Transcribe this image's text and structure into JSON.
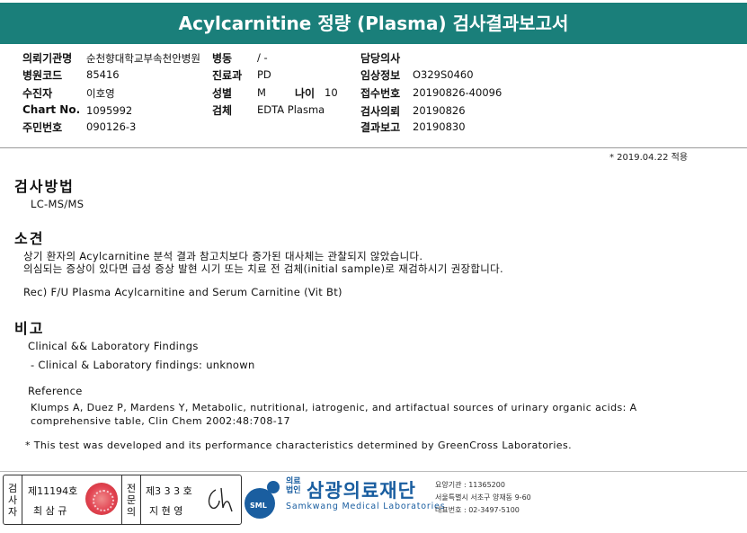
{
  "header": {
    "title": "Acylcarnitine 정량 (Plasma) 검사결과보고서"
  },
  "info": {
    "institution_label": "의뢰기관명",
    "institution_value": "순천향대학교부속천안병원",
    "ward_label": "병동",
    "ward_value": "/ -",
    "doctor_label": "담당의사",
    "doctor_value": "",
    "hospital_code_label": "병원코드",
    "hospital_code_value": "85416",
    "dept_label": "진료과",
    "dept_value": "PD",
    "clinical_info_label": "임상정보",
    "clinical_info_value": "O329S0460",
    "patient_label": "수진자",
    "patient_value": "이호영",
    "sex_label": "성별",
    "sex_value": "M",
    "age_label": "나이",
    "age_value": "10",
    "receipt_label": "접수번호",
    "receipt_value": "20190826-40096",
    "chart_label": "Chart No.",
    "chart_value": "1095992",
    "specimen_label": "검체",
    "specimen_value": "EDTA Plasma",
    "request_label": "검사의뢰",
    "request_value": "20190826",
    "resident_label": "주민번호",
    "resident_value": "090126-3",
    "report_label": "결과보고",
    "report_value": "20190830"
  },
  "applied_date": "* 2019.04.22 적용",
  "method": {
    "heading": "검사방법",
    "text": "LC-MS/MS"
  },
  "findings": {
    "heading": "소견",
    "line1": "상기 환자의 Acylcarnitine 분석 결과 참고치보다 증가된 대사체는 관찰되지 않았습니다.",
    "line2": "의심되는 증상이 있다면 급성 증상 발현 시기 또는 치료 전 검체(initial sample)로 재검하시기 권장합니다.",
    "line3": "Rec) F/U Plasma Acylcarnitine and Serum Carnitine (Vit Bt)"
  },
  "remarks": {
    "heading": "비고",
    "clinical_title": "Clinical && Laboratory Findings",
    "clinical_item": "- Clinical & Laboratory findings: unknown",
    "reference_title": "Reference",
    "reference_line1": "Klumps A, Duez P, Mardens Y, Metabolic, nutritional, iatrogenic, and artifactual sources of urinary organic acids: A",
    "reference_line2": "comprehensive table, Clin Chem 2002:48:708-17",
    "disclaimer": "* This test was developed and its performance characteristics determined by GreenCross Laboratories."
  },
  "footer": {
    "inspector_label": [
      "검",
      "사",
      "자"
    ],
    "inspector_no": "제11194호",
    "inspector_name": "최 삼 규",
    "specialist_label": [
      "전",
      "문",
      "의"
    ],
    "specialist_no": "제3 3 3 호",
    "specialist_name": "지 현 영",
    "logo_small_1": "의료",
    "logo_small_2": "법인",
    "logo_main": "삼광의료재단",
    "logo_eng": "Samkwang Medical Laboratories",
    "logo_badge": "SML",
    "contact_line1": "요양기관 : 11365200",
    "contact_line2": "서울특별시 서초구 양재동 9-60",
    "contact_line3": "대표번호 : 02-3497-5100"
  },
  "colors": {
    "header_bg": "#1a7f7a",
    "brand_blue": "#1a5ea0",
    "seal_red": "#d23"
  }
}
